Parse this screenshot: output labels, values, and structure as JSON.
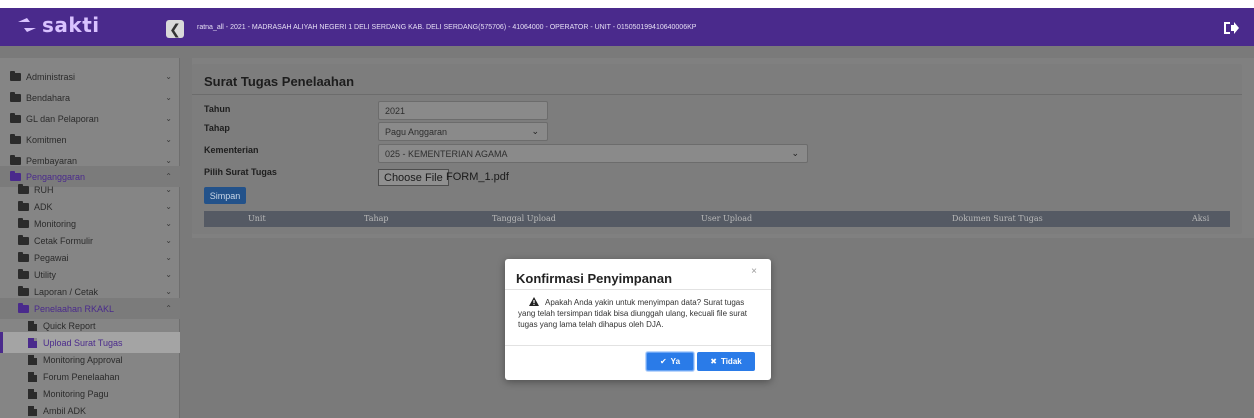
{
  "header": {
    "logo_text": "sakti",
    "collapse_glyph": "❮",
    "session_info": "ratna_all - 2021 - MADRASAH ALIYAH NEGERI 1 DELI SERDANG KAB. DELI SERDANG(575706) - 41064000 - OPERATOR - UNIT - 015050199410640006KP",
    "accent_color": "#4a2a8c",
    "logout_icon": "logout-icon"
  },
  "sidebar": {
    "items": [
      {
        "label": "Administrasi"
      },
      {
        "label": "Bendahara"
      },
      {
        "label": "GL dan Pelaporan"
      },
      {
        "label": "Komitmen"
      },
      {
        "label": "Pembayaran"
      },
      {
        "label": "Penganggaran"
      },
      {
        "label": "RUH"
      },
      {
        "label": "ADK"
      },
      {
        "label": "Monitoring"
      },
      {
        "label": "Cetak Formulir"
      },
      {
        "label": "Pegawai"
      },
      {
        "label": "Utility"
      },
      {
        "label": "Laporan / Cetak"
      },
      {
        "label": "Penelaahan RKAKL"
      },
      {
        "label": "Quick Report"
      },
      {
        "label": "Upload Surat Tugas"
      },
      {
        "label": "Monitoring Approval"
      },
      {
        "label": "Forum Penelaahan"
      },
      {
        "label": "Monitoring Pagu"
      },
      {
        "label": "Ambil ADK"
      }
    ]
  },
  "main": {
    "title": "Surat Tugas Penelaahan",
    "form": {
      "tahun_label": "Tahun",
      "tahun_value": "2021",
      "tahap_label": "Tahap",
      "tahap_value": "Pagu Anggaran",
      "kementerian_label": "Kementerian",
      "kementerian_value": "025 - KEMENTERIAN AGAMA",
      "file_label": "Pilih Surat Tugas",
      "file_button": "Choose File",
      "file_name": "FORM_1.pdf",
      "save_label": "Simpan"
    },
    "table": {
      "columns": [
        "Unit",
        "Tahap",
        "Tanggal Upload",
        "User Upload",
        "Dokumen Surat Tugas",
        "Aksi"
      ]
    }
  },
  "modal": {
    "title": "Konfirmasi Penyimpanan",
    "close": "×",
    "message": "Apakah Anda yakin untuk menyimpan data? Surat tugas yang telah tersimpan tidak bisa diunggah ulang, kecuali file surat tugas yang lama telah dihapus oleh DJA.",
    "confirm_icon": "✔",
    "confirm_label": "Ya",
    "cancel_icon": "✖",
    "cancel_label": "Tidak",
    "button_color": "#2a7be8"
  }
}
